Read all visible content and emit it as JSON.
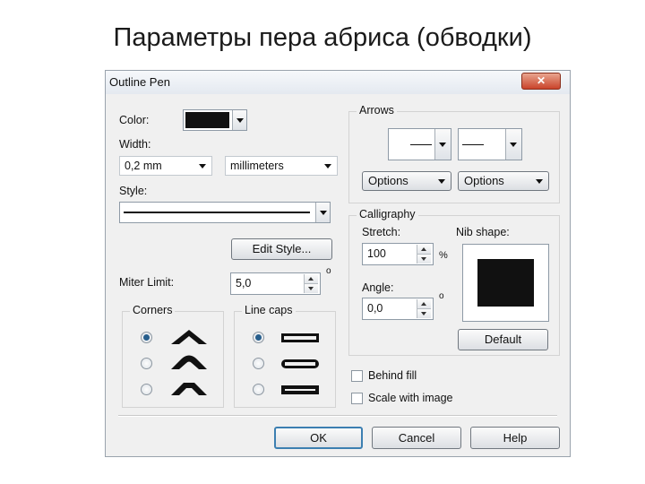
{
  "slide_title": "Параметры пера абриса (обводки)",
  "window": {
    "title": "Outline Pen",
    "close_glyph": "✕"
  },
  "color": {
    "label": "Color:",
    "swatch": "#111111"
  },
  "width": {
    "label": "Width:",
    "value": "0,2 mm",
    "units": "millimeters"
  },
  "style": {
    "label": "Style:"
  },
  "edit_style_label": "Edit Style...",
  "miter": {
    "label": "Miter Limit:",
    "value": "5,0",
    "unit": "o"
  },
  "corners": {
    "label": "Corners",
    "selected_index": 0,
    "options": [
      "sharp-corner",
      "rounded-corner",
      "beveled-corner"
    ]
  },
  "line_caps": {
    "label": "Line caps",
    "selected_index": 0,
    "options": [
      "square-cap",
      "round-cap",
      "extended-cap"
    ]
  },
  "arrows": {
    "label": "Arrows",
    "options_label": "Options"
  },
  "calligraphy": {
    "label": "Calligraphy",
    "stretch_label": "Stretch:",
    "stretch_value": "100",
    "stretch_unit": "%",
    "angle_label": "Angle:",
    "angle_value": "0,0",
    "angle_unit": "o",
    "nib_label": "Nib shape:",
    "default_label": "Default"
  },
  "behind_fill": {
    "label": "Behind fill",
    "checked": false
  },
  "scale_with_image": {
    "label": "Scale with image",
    "checked": false
  },
  "buttons": {
    "ok": "OK",
    "cancel": "Cancel",
    "help": "Help"
  }
}
